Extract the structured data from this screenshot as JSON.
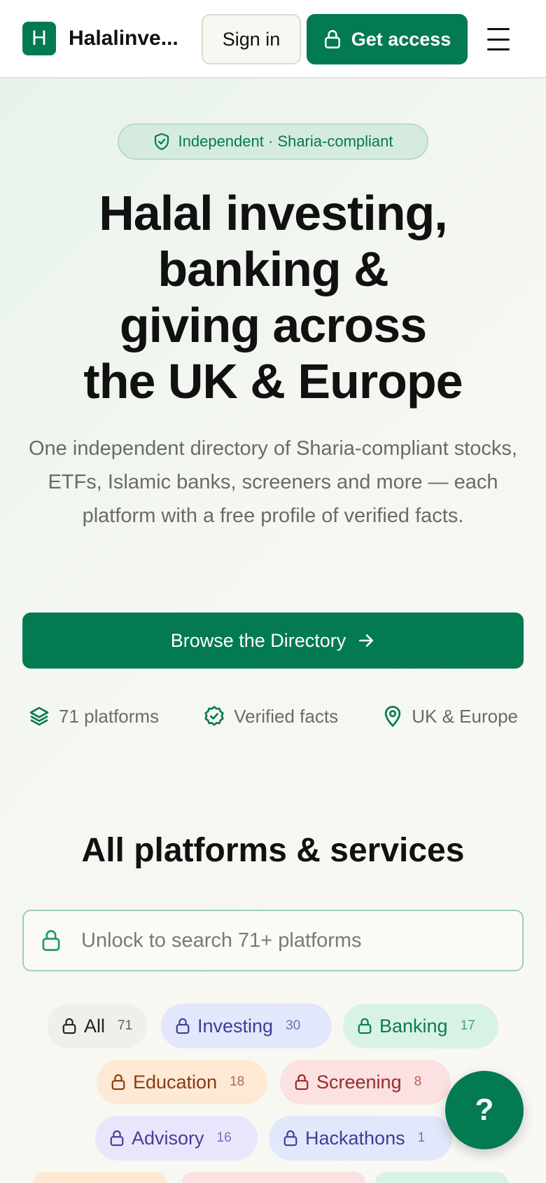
{
  "header": {
    "logo_letter": "H",
    "brand": "Halalinve...",
    "signin_label": "Sign in",
    "get_access_label": "Get access"
  },
  "hero": {
    "badge": "Independent · Sharia-compliant",
    "title_lines": [
      "Halal investing,",
      "banking &",
      "giving across",
      "the UK & Europe"
    ],
    "subtitle": "One independent directory of Sharia-compliant stocks, ETFs, Islamic banks, screeners and more — each platform with a free profile of verified facts.",
    "browse_label": "Browse the Directory",
    "stats": [
      {
        "icon": "layers-icon",
        "label": "71 platforms"
      },
      {
        "icon": "verified-badge-icon",
        "label": "Verified facts"
      },
      {
        "icon": "map-pin-icon",
        "label": "UK & Europe"
      }
    ]
  },
  "platforms": {
    "title": "All platforms & services",
    "search_placeholder": "Unlock to search 71+ platforms",
    "chips": [
      {
        "label": "All",
        "count": "71",
        "bg": "#f0efe9",
        "fg": "#222222"
      },
      {
        "label": "Investing",
        "count": "30",
        "bg": "#e3e7fb",
        "fg": "#3a3f9a"
      },
      {
        "label": "Banking",
        "count": "17",
        "bg": "#d8f3e5",
        "fg": "#0b7a52"
      },
      {
        "label": "Education",
        "count": "18",
        "bg": "#fde9d4",
        "fg": "#8a3a14"
      },
      {
        "label": "Screening",
        "count": "8",
        "bg": "#fbe1e1",
        "fg": "#9a2a2a"
      },
      {
        "label": "Advisory",
        "count": "16",
        "bg": "#ebe5fb",
        "fg": "#4c3a98"
      },
      {
        "label": "Hackathons",
        "count": "1",
        "bg": "#e3e7fb",
        "fg": "#3a3f9a"
      }
    ],
    "partial_chip_colors": [
      "#fde9d4",
      "#fbe1e1",
      "#d8f3e5"
    ]
  },
  "help": {
    "label": "?"
  },
  "colors": {
    "accent": "#047a52"
  }
}
